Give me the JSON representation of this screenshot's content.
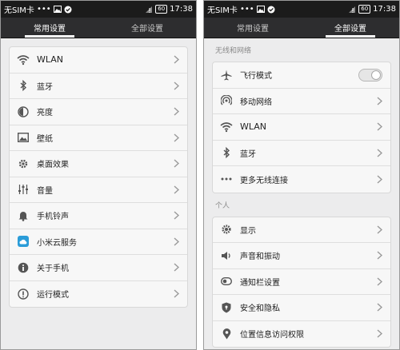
{
  "left": {
    "status": {
      "carrier": "无SIM卡",
      "dots": "•••",
      "battery": "60",
      "time": "17:38"
    },
    "tabs": [
      {
        "label": "常用设置",
        "active": true
      },
      {
        "label": "全部设置",
        "active": false
      }
    ],
    "items": [
      {
        "label": "WLAN",
        "icon": "wifi-icon"
      },
      {
        "label": "蓝牙",
        "icon": "bluetooth-icon"
      },
      {
        "label": "亮度",
        "icon": "brightness-icon"
      },
      {
        "label": "壁纸",
        "icon": "wallpaper-icon"
      },
      {
        "label": "桌面效果",
        "icon": "gear-icon"
      },
      {
        "label": "音量",
        "icon": "volume-sliders-icon"
      },
      {
        "label": "手机铃声",
        "icon": "bell-icon"
      },
      {
        "label": "小米云服务",
        "icon": "cloud-icon"
      },
      {
        "label": "关于手机",
        "icon": "info-icon"
      },
      {
        "label": "运行模式",
        "icon": "run-mode-icon"
      }
    ]
  },
  "right": {
    "status": {
      "carrier": "无SIM卡",
      "dots": "•••",
      "battery": "60",
      "time": "17:38"
    },
    "tabs": [
      {
        "label": "常用设置",
        "active": false
      },
      {
        "label": "全部设置",
        "active": true
      }
    ],
    "sections": [
      {
        "title": "无线和网络",
        "items": [
          {
            "label": "飞行模式",
            "icon": "airplane-icon",
            "toggle": "off"
          },
          {
            "label": "移动网络",
            "icon": "mobile-network-icon"
          },
          {
            "label": "WLAN",
            "icon": "wifi-icon"
          },
          {
            "label": "蓝牙",
            "icon": "bluetooth-icon"
          },
          {
            "label": "更多无线连接",
            "icon": "more-dots-icon"
          }
        ]
      },
      {
        "title": "个人",
        "items": [
          {
            "label": "显示",
            "icon": "display-icon"
          },
          {
            "label": "声音和振动",
            "icon": "sound-icon"
          },
          {
            "label": "通知栏设置",
            "icon": "notification-icon"
          },
          {
            "label": "安全和隐私",
            "icon": "shield-icon"
          },
          {
            "label": "位置信息访问权限",
            "icon": "location-icon"
          }
        ]
      }
    ]
  }
}
